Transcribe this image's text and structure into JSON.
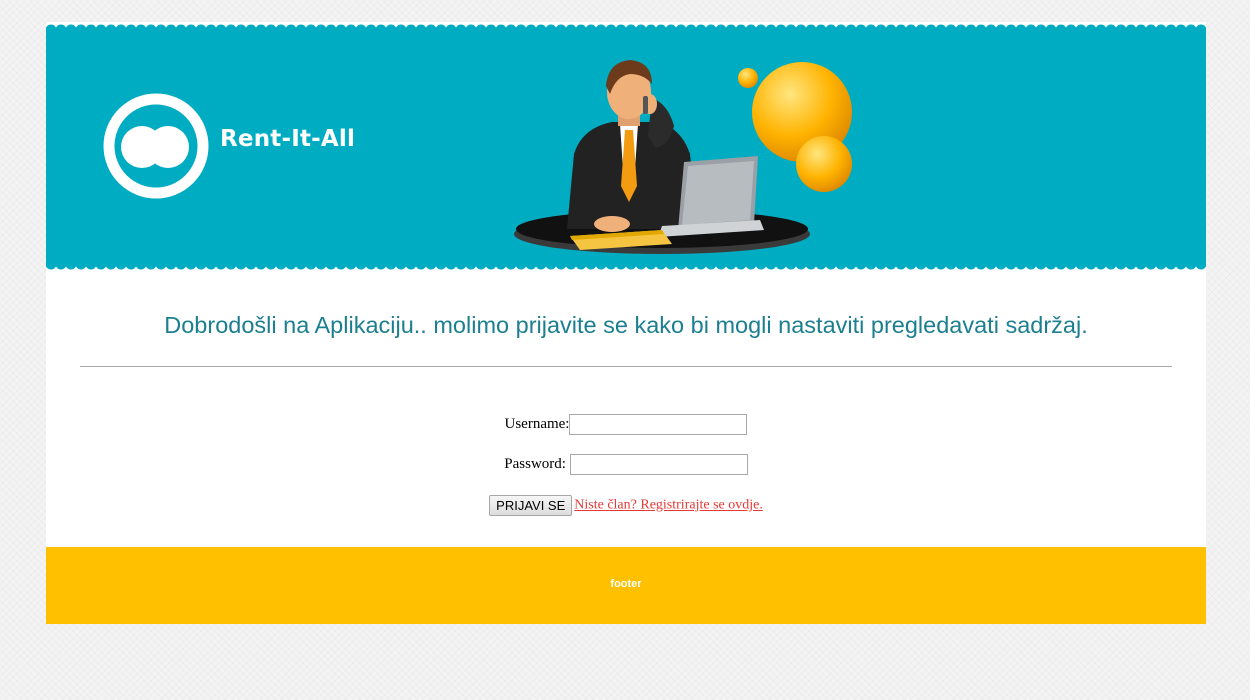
{
  "header": {
    "brand": "Rent-It-All",
    "colors": {
      "header_bg": "#00acc1",
      "footer_bg": "#ffc000"
    }
  },
  "main": {
    "welcome": "Dobrodošli na Aplikaciju.. molimo prijavite se kako bi mogli nastaviti pregledavati sadržaj."
  },
  "form": {
    "username_label": "Username:",
    "username_value": "",
    "password_label": "Password:",
    "password_value": "",
    "submit_label": "PRIJAVI SE",
    "register_link": "Niste član? Registrirajte se ovdje."
  },
  "footer": {
    "text": "footer"
  },
  "icons": {
    "logo": "rent-it-all-logo-icon",
    "hero": "businessman-laptop-illustration",
    "bubble": "thought-bubble-icon"
  }
}
